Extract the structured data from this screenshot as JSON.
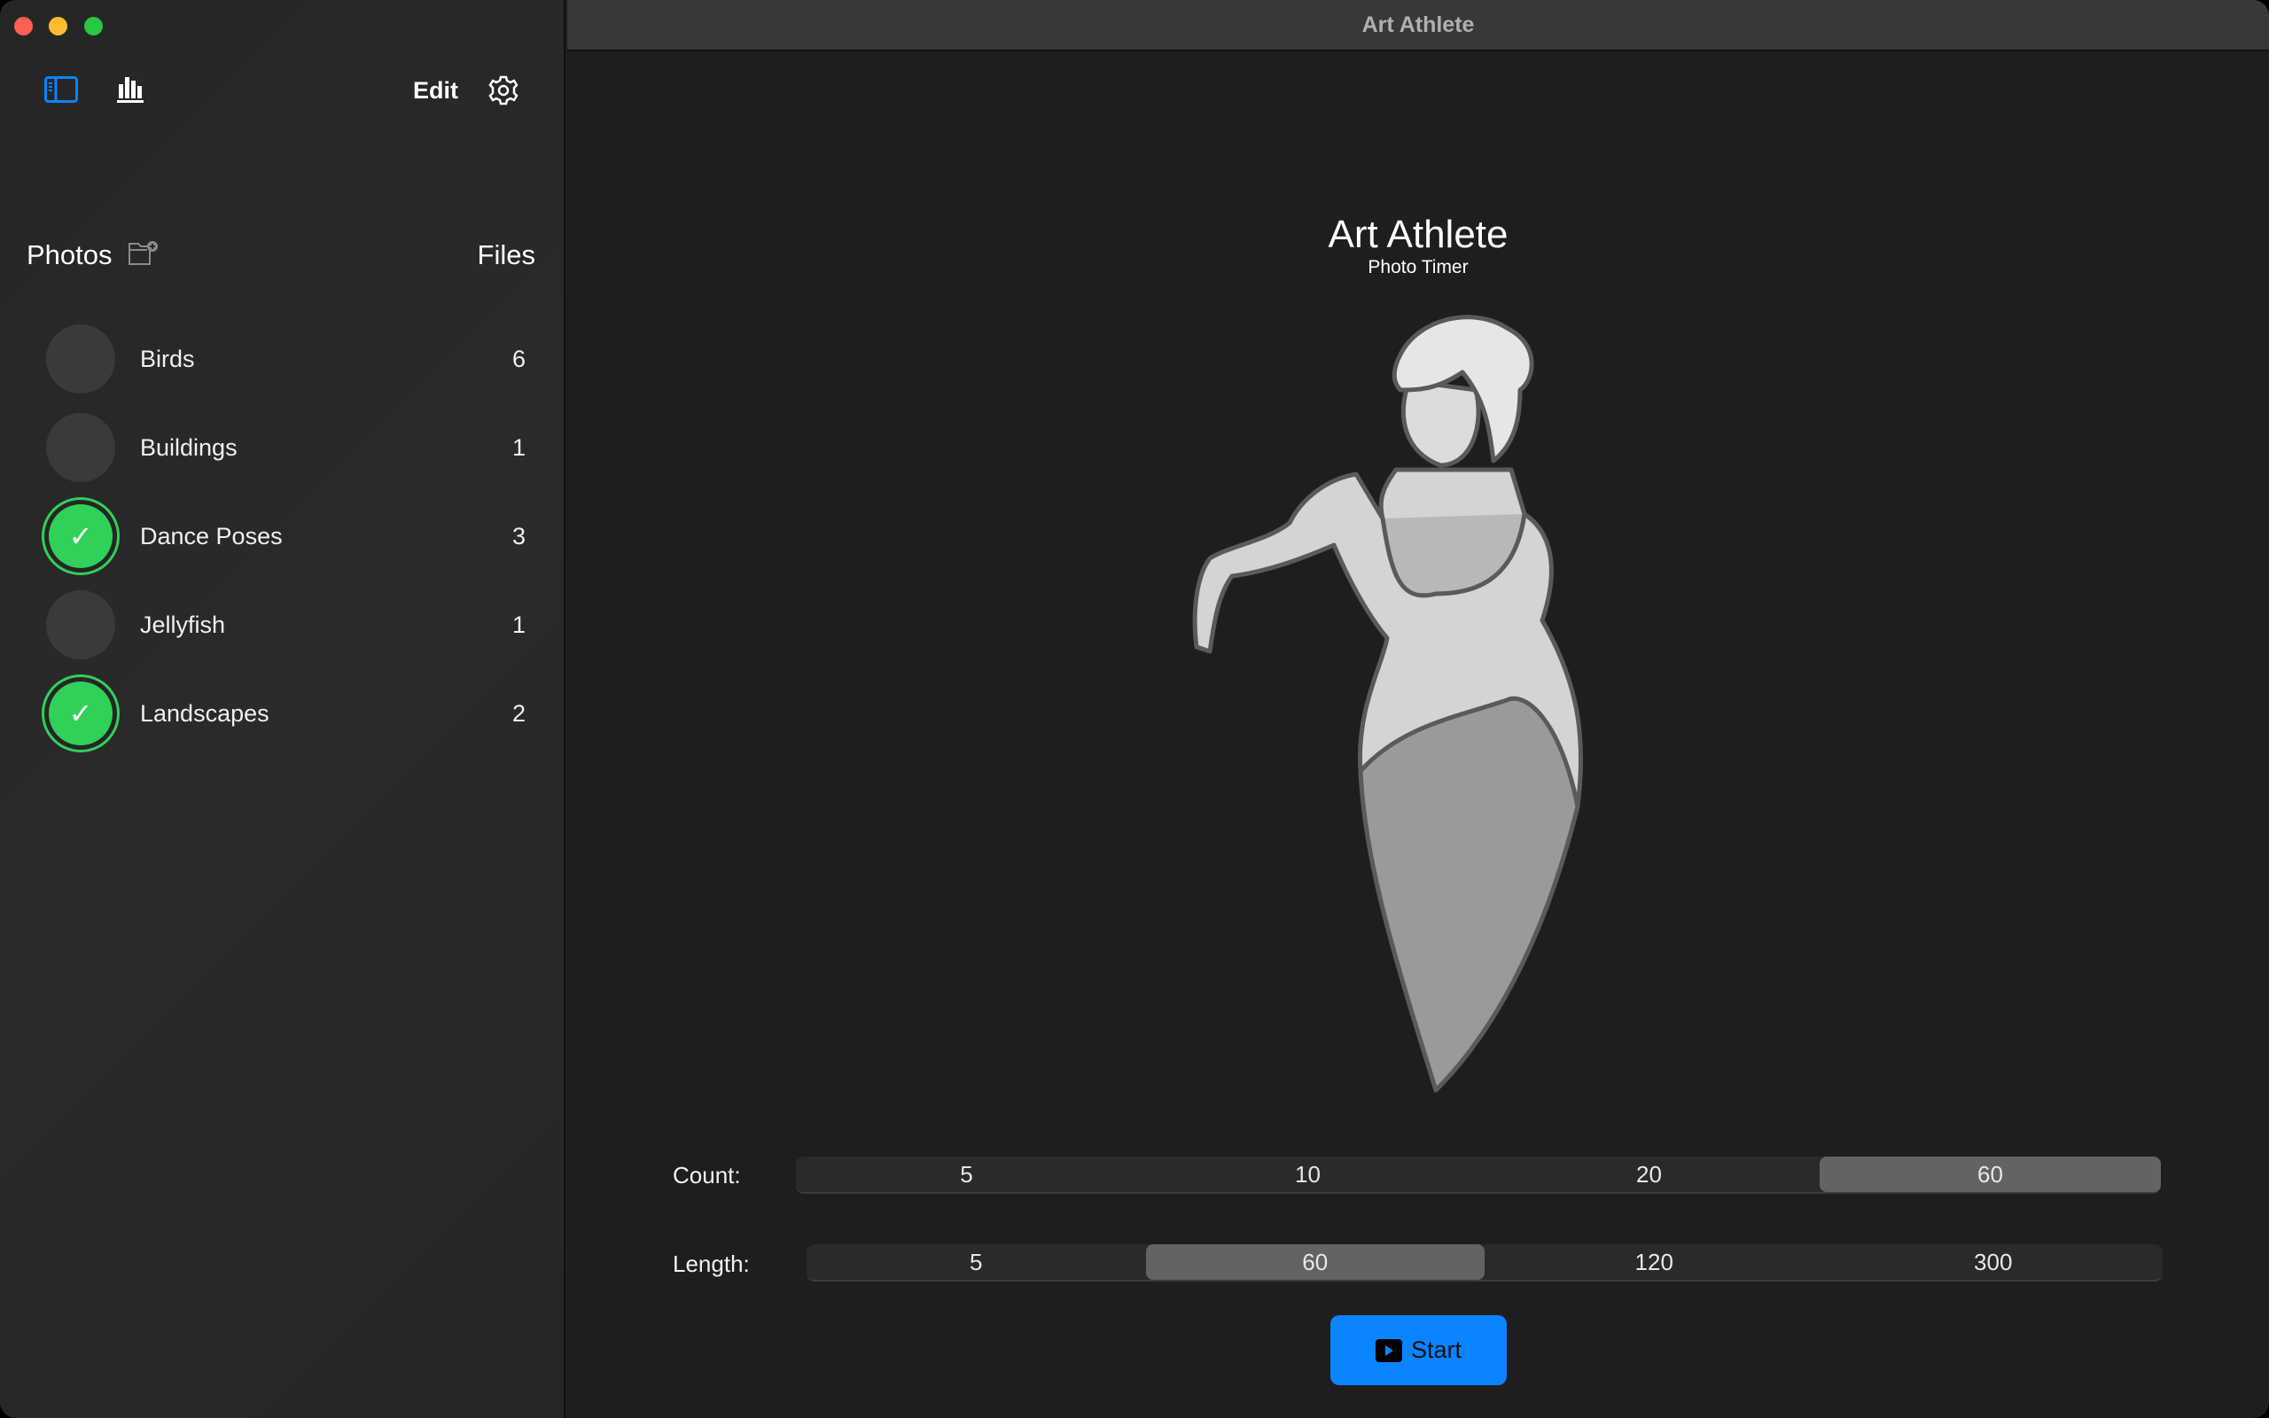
{
  "window": {
    "title": "Art Athlete"
  },
  "toolbar": {
    "edit_label": "Edit",
    "icons": [
      "sidebar-icon",
      "chart-bar-icon",
      "gear-icon"
    ]
  },
  "sidebar": {
    "header": {
      "title": "Photos",
      "files_label": "Files"
    },
    "items": [
      {
        "label": "Birds",
        "count": "6",
        "selected": false
      },
      {
        "label": "Buildings",
        "count": "1",
        "selected": false
      },
      {
        "label": "Dance Poses",
        "count": "3",
        "selected": true
      },
      {
        "label": "Jellyfish",
        "count": "1",
        "selected": false
      },
      {
        "label": "Landscapes",
        "count": "2",
        "selected": true
      }
    ]
  },
  "main": {
    "title": "Art Athlete",
    "subtitle": "Photo Timer",
    "count": {
      "label": "Count:",
      "options": [
        "5",
        "10",
        "20",
        "60"
      ],
      "selected": "60"
    },
    "length": {
      "label": "Length:",
      "options": [
        "5",
        "60",
        "120",
        "300"
      ],
      "selected": "60"
    },
    "start_label": "Start"
  },
  "colors": {
    "accent": "#0a84ff",
    "selected": "#30d158"
  }
}
